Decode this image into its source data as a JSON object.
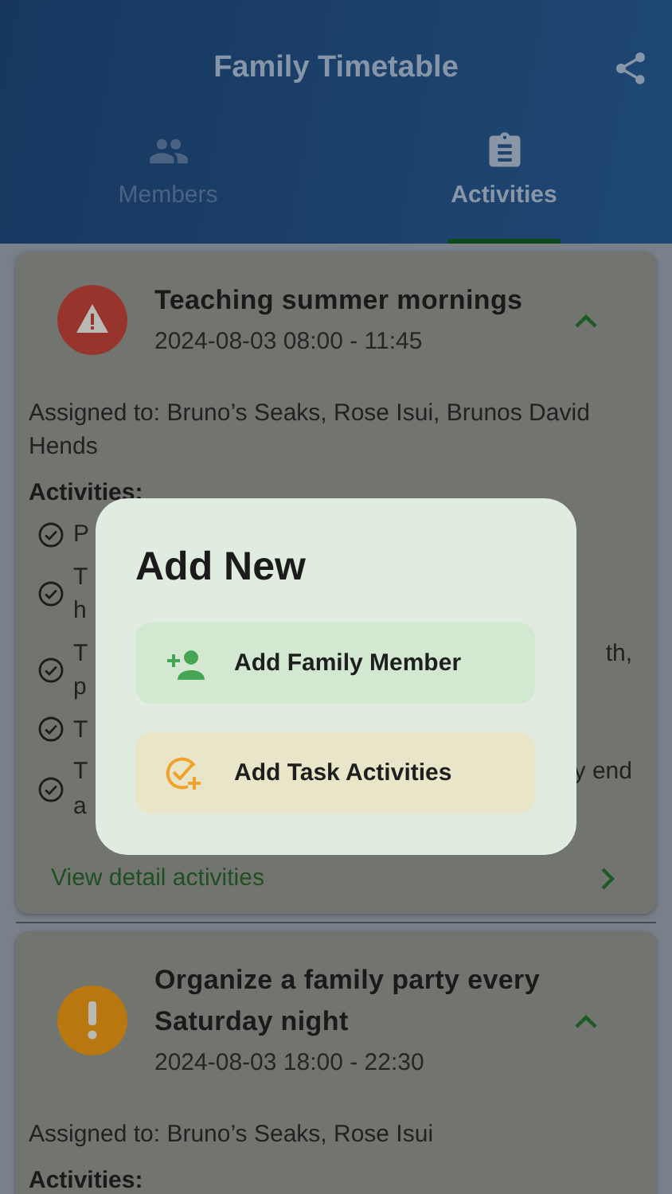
{
  "app_bar": {
    "title": "Family Timetable"
  },
  "tabs": [
    {
      "label": "Members",
      "selected": false
    },
    {
      "label": "Activities",
      "selected": true
    }
  ],
  "cards": [
    {
      "kind": "alert",
      "title": "Teaching summer mornings",
      "time": "2024-08-03 08:00 - 11:45",
      "expanded": true,
      "assigned": "Assigned to: Bruno’s Seaks, Rose Isui, Brunos David Hends",
      "activities_label": "Activities:",
      "activities": [
        {
          "left": [
            "P"
          ]
        },
        {
          "left": [
            "T",
            "h"
          ]
        },
        {
          "left": [
            "T",
            "p"
          ],
          "right": "th,"
        },
        {
          "left": [
            "T"
          ]
        },
        {
          "left": [
            "T",
            "a"
          ],
          "right": "y end"
        }
      ],
      "link": "View detail activities"
    },
    {
      "kind": "warning",
      "title": "Organize a family party every Saturday night",
      "time": "2024-08-03 18:00 - 22:30",
      "expanded": true,
      "assigned": "Assigned to: Bruno’s Seaks, Rose Isui",
      "activities_label": "Activities:"
    }
  ],
  "dialog": {
    "title": "Add New",
    "options": [
      {
        "kind": "member",
        "label": "Add Family Member"
      },
      {
        "kind": "task",
        "label": "Add Task Activities"
      }
    ]
  }
}
